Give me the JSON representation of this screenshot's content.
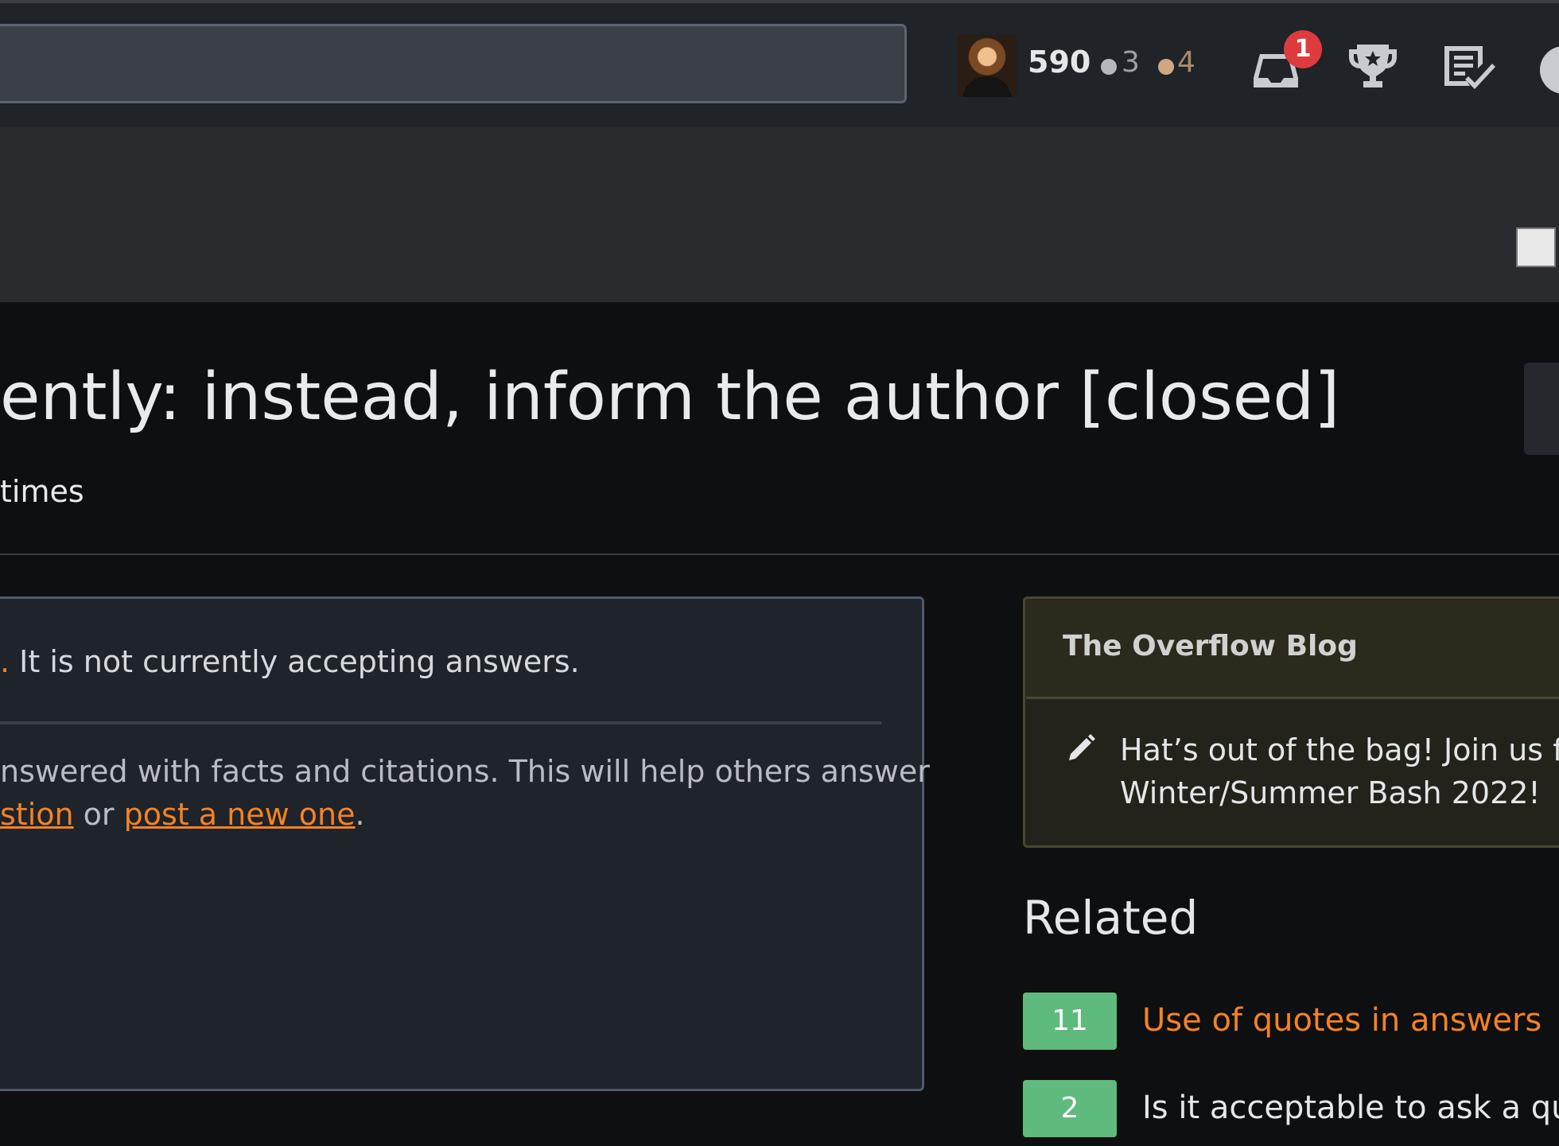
{
  "topbar": {
    "reputation": "590",
    "silver_badges": "3",
    "bronze_badges": "4",
    "inbox_count": "1"
  },
  "question": {
    "title": "ently: instead, inform the author [closed]",
    "viewed": "times"
  },
  "notice": {
    "line1_link": ".",
    "line1_text": " It is not currently accepting answers.",
    "line2": "nswered with facts and citations. This will help others answer",
    "line3_link1": "stion",
    "line3_mid": " or ",
    "line3_link2": "post a new one",
    "line3_end": "."
  },
  "blog": {
    "title": "The Overflow Blog",
    "item_line1": "Hat’s out of the bag! Join us fo",
    "item_line2": "Winter/Summer Bash 2022!"
  },
  "related": {
    "heading": "Related",
    "items": [
      {
        "score": "11",
        "title": "Use of quotes in answers"
      },
      {
        "score": "2",
        "title": "Is it acceptable to ask a quest"
      }
    ]
  },
  "colors": {
    "accent": "#f48225",
    "score_green": "#5eba7d",
    "inbox_red": "#de3b3e"
  },
  "icons": [
    "inbox-icon",
    "trophy-icon",
    "review-queue-icon",
    "help-icon",
    "pencil-icon",
    "extension-icon"
  ]
}
